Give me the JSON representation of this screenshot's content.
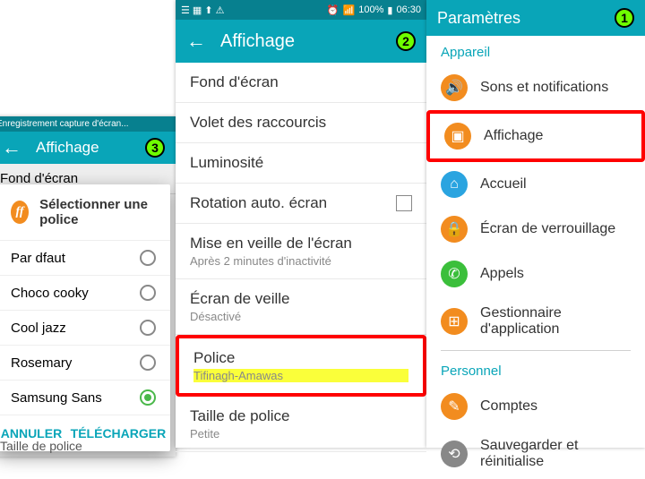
{
  "screen1": {
    "title": "Paramètres",
    "sections": {
      "appareil": {
        "label": "Appareil",
        "items": [
          {
            "icon": "🔊",
            "color": "#f28c1f",
            "label": "Sons et notifications"
          },
          {
            "icon": "▣",
            "color": "#f28c1f",
            "label": "Affichage",
            "highlight": true
          },
          {
            "icon": "⌂",
            "color": "#2aa4e0",
            "label": "Accueil"
          },
          {
            "icon": "🔒",
            "color": "#f28c1f",
            "label": "Écran de verrouillage"
          },
          {
            "icon": "✆",
            "color": "#3bbf3b",
            "label": "Appels"
          },
          {
            "icon": "⊞",
            "color": "#f28c1f",
            "label": "Gestionnaire d'application"
          }
        ]
      },
      "personnel": {
        "label": "Personnel",
        "items": [
          {
            "icon": "✎",
            "color": "#f28c1f",
            "label": "Comptes"
          },
          {
            "icon": "⟲",
            "color": "#888",
            "label": "Sauvegarder et réinitialise"
          }
        ]
      }
    }
  },
  "screen2": {
    "status": {
      "time": "06:30",
      "battery": "100%"
    },
    "title": "Affichage",
    "items": [
      {
        "label": "Fond d'écran"
      },
      {
        "label": "Volet des raccourcis"
      },
      {
        "label": "Luminosité"
      },
      {
        "label": "Rotation auto. écran",
        "checkbox": true
      },
      {
        "label": "Mise en veille de l'écran",
        "sub": "Après 2 minutes d'inactivité"
      },
      {
        "label": "Écran de veille",
        "sub": "Désactivé"
      },
      {
        "label": "Police",
        "sub": "Tifinagh-Amawas",
        "highlight": true
      },
      {
        "label": "Taille de police",
        "sub": "Petite"
      }
    ]
  },
  "screen3": {
    "toast": "Enregistrement capture d'écran...",
    "title": "Affichage",
    "bgitems": [
      "Fond d'écran",
      "Taille de police"
    ],
    "dialog": {
      "title": "Sélectionner une police",
      "options": [
        "Par dfaut",
        "Choco cooky",
        "Cool jazz",
        "Rosemary",
        "Samsung Sans"
      ],
      "selected": 4,
      "cancel": "ANNULER",
      "download": "TÉLÉCHARGER"
    }
  }
}
